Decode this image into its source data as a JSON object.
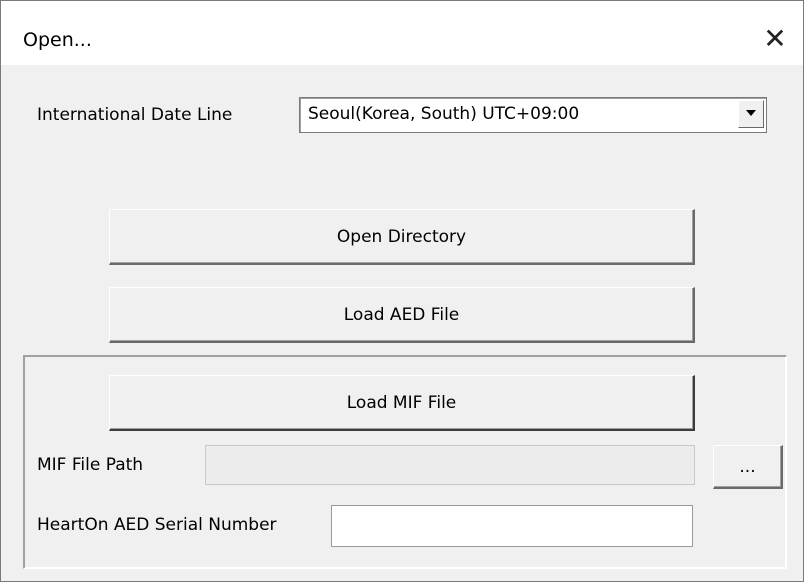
{
  "window": {
    "title": "Open...",
    "close_glyph": "✕"
  },
  "timezone": {
    "label": "International Date Line",
    "selected": "Seoul(Korea, South) UTC+09:00"
  },
  "buttons": {
    "open_directory": "Open Directory",
    "load_aed": "Load AED File",
    "load_mif": "Load MIF File",
    "browse": "..."
  },
  "mif": {
    "path_label": "MIF File Path",
    "path_value": "",
    "serial_label": "HeartOn AED Serial Number",
    "serial_value": ""
  },
  "icons": {
    "close": "close-icon",
    "dropdown": "chevron-down-icon"
  }
}
